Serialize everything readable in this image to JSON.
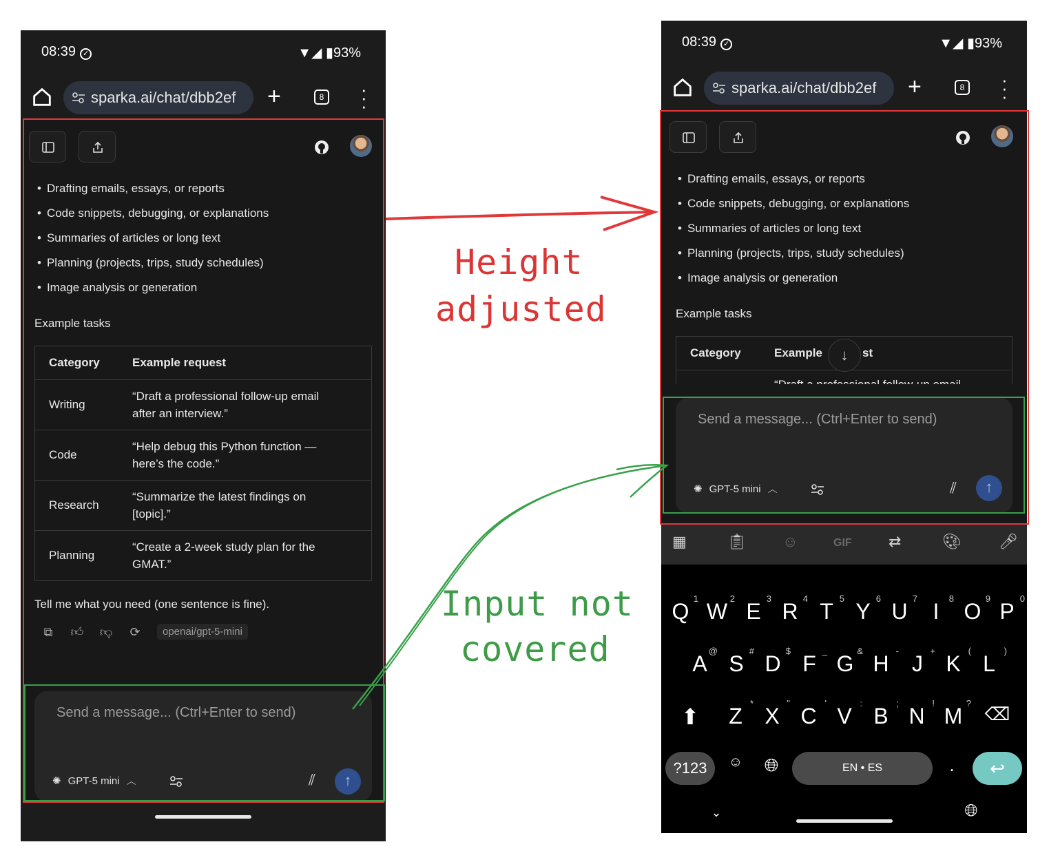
{
  "status": {
    "time": "08:39",
    "battery": "93%"
  },
  "browser": {
    "url": "sparka.ai/chat/dbb2ef",
    "tab_count": "8"
  },
  "chat": {
    "bullets": [
      "Drafting emails, essays, or reports",
      "Code snippets, debugging, or explanations",
      "Summaries of articles or long text",
      "Planning (projects, trips, study schedules)",
      "Image analysis or generation"
    ],
    "section_title": "Example tasks",
    "table": {
      "headers": [
        "Category",
        "Example request"
      ],
      "rows": [
        {
          "category": "Writing",
          "line1": "“Draft a professional follow-up email",
          "line2": "after an interview.”"
        },
        {
          "category": "Code",
          "line1": "“Help debug this Python function —",
          "line2": "here’s the code.”"
        },
        {
          "category": "Research",
          "line1": "“Summarize the latest findings on",
          "line2": "[topic].”"
        },
        {
          "category": "Planning",
          "line1": "“Create a 2-week study plan for the",
          "line2": "GMAT.”"
        }
      ]
    },
    "right_partial_header": {
      "category": "Category",
      "left": "Example",
      "right": "st"
    },
    "right_partial_row": "“Draft a professional follow-up email",
    "tell_me": "Tell me what you need (one sentence is fine).",
    "model_badge": "openai/gpt-5-mini"
  },
  "composer": {
    "placeholder": "Send a message... (Ctrl+Enter to send)",
    "model_name": "GPT-5 mini"
  },
  "keyboard": {
    "row1": [
      [
        "Q",
        "1"
      ],
      [
        "W",
        "2"
      ],
      [
        "E",
        "3"
      ],
      [
        "R",
        "4"
      ],
      [
        "T",
        "5"
      ],
      [
        "Y",
        "6"
      ],
      [
        "U",
        "7"
      ],
      [
        "I",
        "8"
      ],
      [
        "O",
        "9"
      ],
      [
        "P",
        "0"
      ]
    ],
    "row2": [
      [
        "A",
        "@"
      ],
      [
        "S",
        "#"
      ],
      [
        "D",
        "$"
      ],
      [
        "F",
        "_"
      ],
      [
        "G",
        "&"
      ],
      [
        "H",
        "-"
      ],
      [
        "J",
        "+"
      ],
      [
        "K",
        "("
      ],
      [
        "L",
        ")"
      ]
    ],
    "row3": [
      [
        "Z",
        "*"
      ],
      [
        "X",
        "\""
      ],
      [
        "C",
        "'"
      ],
      [
        "V",
        ":"
      ],
      [
        "B",
        ";"
      ],
      [
        "N",
        "!"
      ],
      [
        "M",
        "?"
      ]
    ],
    "symbols_key": "?123",
    "space_label": "EN • ES",
    "gif_label": "GIF",
    "period": "."
  },
  "annotations": {
    "height_line1": "Height",
    "height_line2": "adjusted",
    "input_line1": "Input not",
    "input_line2": "covered"
  },
  "colors": {
    "annotation_red": "#e0393a",
    "annotation_green": "#38a14a",
    "send_button": "#2f4f8f",
    "enter_key": "#76c9c2"
  }
}
